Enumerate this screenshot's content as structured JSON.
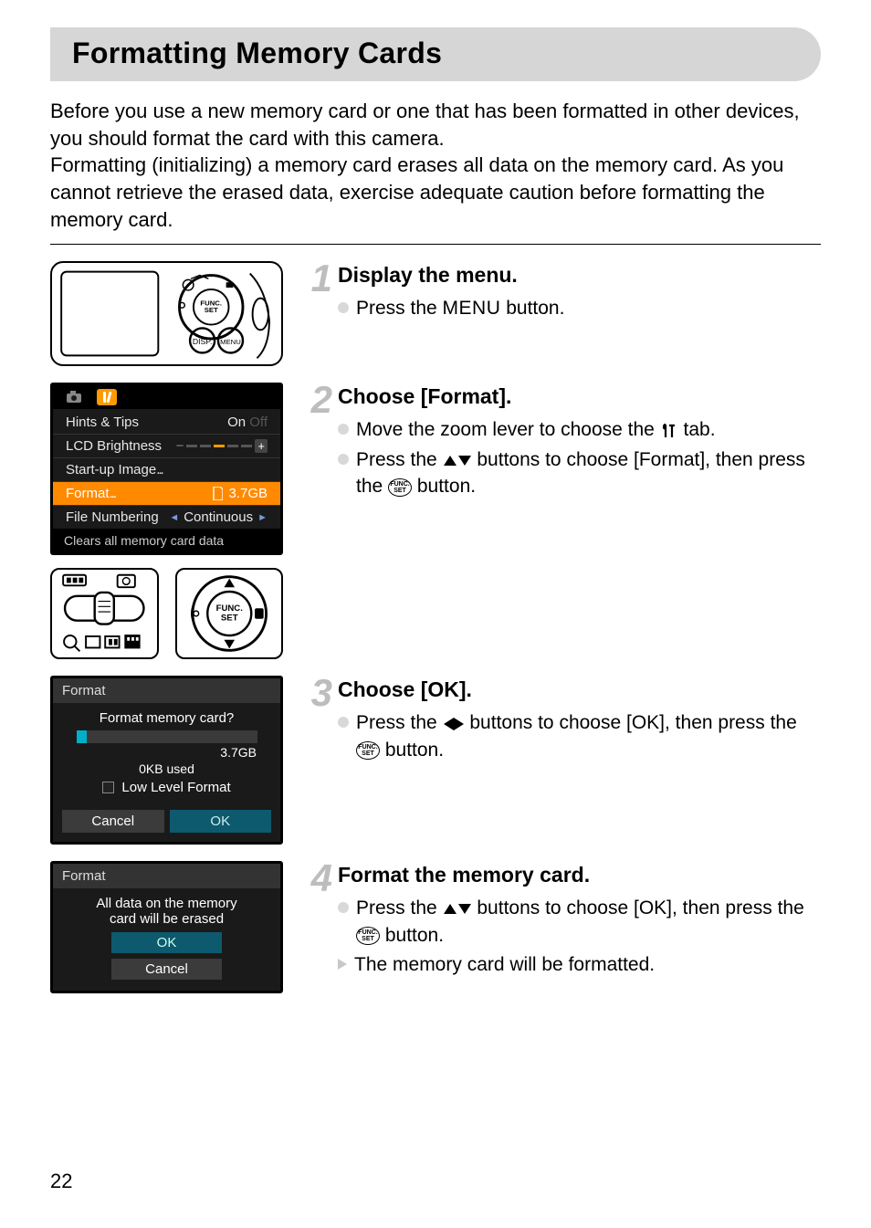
{
  "page_number": "22",
  "title": "Formatting Memory Cards",
  "intro": "Before you use a new memory card or one that has been formatted in other devices, you should format the card with this camera.\nFormatting (initializing) a memory card erases all data on the memory card. As you cannot retrieve the erased data, exercise adequate caution before formatting the memory card.",
  "steps": [
    {
      "num": "1",
      "title": "Display the menu.",
      "bullets": [
        {
          "type": "dot",
          "pre": "Press the ",
          "menu": "MENU",
          "post": " button."
        }
      ]
    },
    {
      "num": "2",
      "title": "Choose [Format].",
      "bullets": [
        {
          "type": "dot",
          "text_a": "Move the zoom lever to choose the ",
          "icon": "tools",
          "text_b": " tab."
        },
        {
          "type": "dot",
          "text_a": "Press the ",
          "icon": "updown",
          "text_b": " buttons to choose [Format], then press the ",
          "icon2": "funcset",
          "text_c": " button."
        }
      ]
    },
    {
      "num": "3",
      "title": "Choose [OK].",
      "bullets": [
        {
          "type": "dot",
          "text_a": "Press the ",
          "icon": "leftright",
          "text_b": " buttons to choose [OK], then press the ",
          "icon2": "funcset",
          "text_c": " button."
        }
      ]
    },
    {
      "num": "4",
      "title": "Format the memory card.",
      "bullets": [
        {
          "type": "dot",
          "text_a": "Press the ",
          "icon": "updown",
          "text_b": " buttons to choose [OK], then press the ",
          "icon2": "funcset",
          "text_c": " button."
        },
        {
          "type": "tri",
          "plain": "The memory card will be formatted."
        }
      ]
    }
  ],
  "menu_screen": {
    "rows": [
      {
        "label": "Hints & Tips",
        "value": "On",
        "off": "Off"
      },
      {
        "label": "LCD Brightness",
        "slider": true
      },
      {
        "label": "Start-up Image",
        "value": ""
      },
      {
        "label": "Format",
        "value": "3.7GB",
        "selected": true,
        "card_icon": true
      },
      {
        "label": "File Numbering",
        "value": "Continuous",
        "arrows": true
      }
    ],
    "footer": "Clears all memory card data"
  },
  "dialog1": {
    "title": "Format",
    "question": "Format memory card?",
    "capacity": "3.7GB",
    "used": "0KB used",
    "low_level": "Low Level Format",
    "cancel": "Cancel",
    "ok": "OK"
  },
  "dialog2": {
    "title": "Format",
    "line1": "All data on the memory",
    "line2": "card will be erased",
    "ok": "OK",
    "cancel": "Cancel"
  },
  "funcset_label": "FUNC.\nSET"
}
